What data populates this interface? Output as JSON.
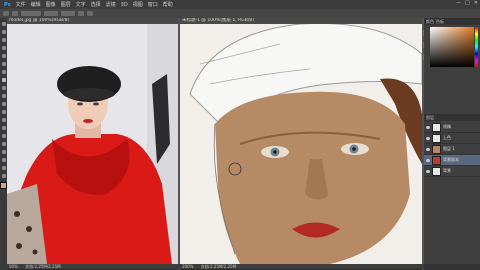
{
  "menu": {
    "items": [
      "Ps",
      "文件",
      "编辑",
      "图像",
      "图层",
      "文字",
      "选择",
      "滤镜",
      "3D",
      "视图",
      "窗口",
      "帮助"
    ],
    "window_controls": [
      "—",
      "□",
      "✕"
    ]
  },
  "left_doc": {
    "tab_label": "model.jpg @ 100%(RGB/8)",
    "zoom": "50%",
    "status": "文档:2.25M/2.25M"
  },
  "right_doc": {
    "tab_label": "未标题-1 @ 100%(图层 1, RGB/8)",
    "zoom": "200%",
    "status": "文档:2.25M/2.25M"
  },
  "panels": {
    "tabs": [
      "颜色",
      "色板"
    ],
    "layers_header": "图层",
    "layers": [
      {
        "name": "线稿",
        "selected": false
      },
      {
        "name": "上色",
        "selected": false
      },
      {
        "name": "图层 1",
        "selected": false
      },
      {
        "name": "背景副本",
        "selected": true
      },
      {
        "name": "背景",
        "selected": false
      }
    ]
  },
  "colors": {
    "accent": "#596a80",
    "foreground": "#d9a37a"
  }
}
